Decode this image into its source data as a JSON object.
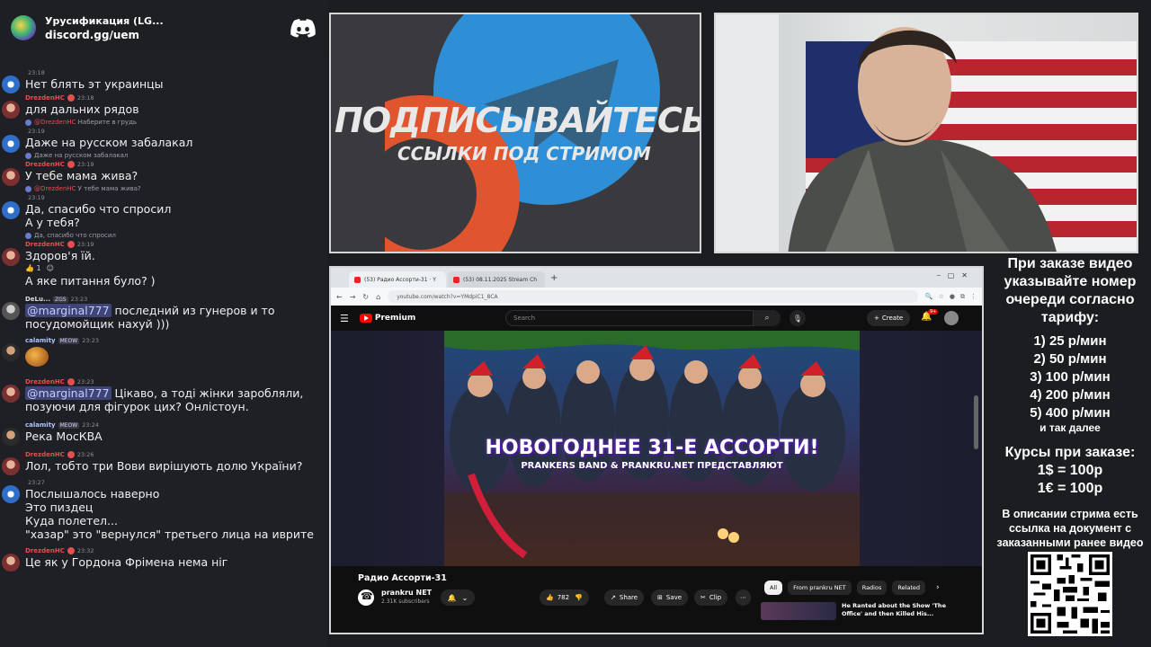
{
  "chat": {
    "server_name": "Урусификация (LG...",
    "server_link": "discord.gg/uem",
    "messages": [
      {
        "user": "",
        "time": "23:18",
        "text": "Нет блять эт украинцы",
        "color": "gold",
        "avatar": "blue"
      },
      {
        "user": "DrezdenHC",
        "time": "23:18",
        "text": "для дальних рядов",
        "color": "red",
        "avatar": "red"
      },
      {
        "reply_user": "@DrezdenHC",
        "reply_text": "Наберите в грудь",
        "user": "",
        "time": "23:19",
        "text": "Даже на русском забалакал",
        "color": "gold",
        "avatar": "blue"
      },
      {
        "reply_text": "Даже на русском забалакал",
        "user": "DrezdenHC",
        "time": "23:19",
        "text": "У тебе мама жива?",
        "color": "red",
        "avatar": "red"
      },
      {
        "reply_user": "@DrezdenHC",
        "reply_text": "У тебе мама жива?",
        "user": "",
        "time": "23:19",
        "text": "Да, спасибо что спросил",
        "text2": "А у тебя?",
        "color": "gold",
        "avatar": "blue"
      },
      {
        "reply_text": "Да, спасибо что спросил",
        "user": "DrezdenHC",
        "time": "23:19",
        "text": "Здоров'я їй.",
        "react_count": "1",
        "text2": "А яке питання було? )",
        "color": "red",
        "avatar": "red"
      },
      {
        "user": "DeLu...",
        "tag": "ZGS",
        "time": "23:23",
        "mention": "@marginal777",
        "text": " последний из гунеров и то посудомойщик нахуй )))",
        "color": "white",
        "avatar": "gray"
      },
      {
        "user": "calamity",
        "tag": "MEOW",
        "time": "23:23",
        "sticker": true,
        "color": "teal",
        "avatar": "dark"
      },
      {
        "user": "DrezdenHC",
        "time": "23:23",
        "mention": "@marginal777",
        "text": "  Цікаво, а тоді жінки заробляли, позуючи для фігурок цих? Онлістоун.",
        "color": "red",
        "avatar": "red"
      },
      {
        "user": "calamity",
        "tag": "MEOW",
        "time": "23:24",
        "text": "Река МосКВА",
        "color": "teal",
        "avatar": "dark"
      },
      {
        "user": "DrezdenHC",
        "time": "23:26",
        "text": "Лол, тобто три Вови вирішують долю України?",
        "color": "red",
        "avatar": "red"
      },
      {
        "user": "",
        "time": "23:27",
        "text": "Послышалось наверно",
        "text2": "Это пиздец",
        "text3": "Куда полетел...",
        "text4": "\"хазар\" это \"вернулся\" третьего лица на иврите",
        "color": "gold",
        "avatar": "blue"
      },
      {
        "user": "DrezdenHC",
        "time": "23:32",
        "text": "Це як у Гордона Фрімена нема ніг",
        "color": "red",
        "avatar": "red"
      }
    ]
  },
  "promo": {
    "title": "ПОДПИСЫВАЙТЕСЬ",
    "subtitle": "ССЫЛКИ ПОД СТРИМОМ"
  },
  "browser": {
    "tab1": "(53) Радио Ассорти-31 · Y",
    "tab2": "(53) 08.11.2025 Stream Ch",
    "url": "youtube.com/watch?v=YMdpiC1_8CA",
    "yt_brand": "Premium",
    "search_placeholder": "Search",
    "create_label": "Create",
    "notif_count": "9+",
    "thumb_title": "НОВОГОДНЕЕ 31-Е АССОРТИ!",
    "thumb_subtitle": "PRANKERS BAND & PRANKRU.NET ПРЕДСТАВЛЯЮТ",
    "video_title": "Радио Ассорти-31",
    "channel_name": "prankru NET",
    "channel_subs": "2.31K subscribers",
    "likes": "782",
    "share": "Share",
    "save": "Save",
    "clip": "Clip",
    "chips": [
      "All",
      "From prankru NET",
      "Radios",
      "Related"
    ],
    "rec_title": "He Ranted about the Show 'The Office' and then Killed His..."
  },
  "info": {
    "heading": "При заказе видео указывайте номер очереди согласно тарифу:",
    "tariffs": [
      "1) 25 р/мин",
      "2) 50 р/мин",
      "3) 100 р/мин",
      "4) 200 р/мин",
      "5) 400 р/мин"
    ],
    "tariff_more": "и так далее",
    "courses_head": "Курсы при заказе:",
    "rate1": "1$ = 100р",
    "rate2": "1€ = 100р",
    "description": "В описании стрима есть ссылка на документ с заказанными ранее видео"
  }
}
